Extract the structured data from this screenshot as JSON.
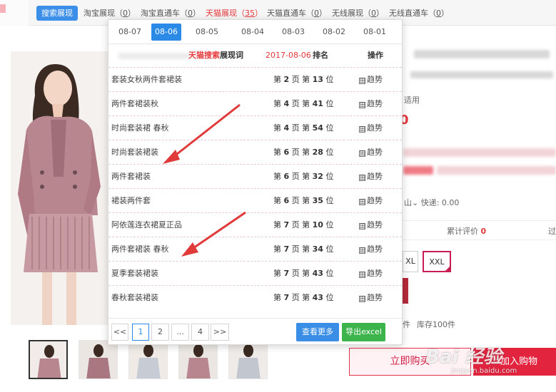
{
  "tabs": {
    "search_label": "搜索展现",
    "items": [
      {
        "label": "淘宝展现（",
        "count": "0",
        "close": "）"
      },
      {
        "label": "淘宝直通车（",
        "count": "0",
        "close": "）"
      },
      {
        "label": "天猫展现（",
        "count": "35",
        "close": "）"
      },
      {
        "label": "天猫直通车（",
        "count": "0",
        "close": "）"
      },
      {
        "label": "无线展现（",
        "count": "0",
        "close": "）"
      },
      {
        "label": "无线直通车（",
        "count": "0",
        "close": "）"
      }
    ],
    "active_index": 2
  },
  "popup": {
    "dates": [
      "08-07",
      "08-06",
      "08-05",
      "08-04",
      "08-03",
      "08-02",
      "08-01"
    ],
    "active_date_index": 1,
    "header": {
      "keyword_prefix": "天猫搜索",
      "keyword_suffix": "展现词",
      "date": "2017-08-06",
      "rank": "排名",
      "op": "操作"
    },
    "rows": [
      {
        "keyword": "套装女秋两件套裙装",
        "page": "2",
        "pos": "13"
      },
      {
        "keyword": "两件套裙装秋",
        "page": "4",
        "pos": "41"
      },
      {
        "keyword": "时尚套装裙 春秋",
        "page": "4",
        "pos": "54"
      },
      {
        "keyword": "时尚套装裙装",
        "page": "6",
        "pos": "28"
      },
      {
        "keyword": "两件套裙装",
        "page": "6",
        "pos": "32"
      },
      {
        "keyword": "裙装两件套",
        "page": "6",
        "pos": "35"
      },
      {
        "keyword": "阿依莲连衣裙夏正品",
        "page": "7",
        "pos": "10"
      },
      {
        "keyword": "两件套裙装 春秋",
        "page": "7",
        "pos": "34"
      },
      {
        "keyword": "夏季套装裙装",
        "page": "7",
        "pos": "43"
      },
      {
        "keyword": "春秋套装裙装",
        "page": "7",
        "pos": "43"
      }
    ],
    "rank_words": {
      "di": "第",
      "ye": "页",
      "wei": "位"
    },
    "trend_label": "趋势",
    "trend_box": "田",
    "pager": {
      "prev": "<<",
      "pages": [
        "1",
        "2",
        "...",
        "4"
      ],
      "current": "1",
      "next": ">>",
      "more": "查看更多",
      "excel": "导出excel"
    }
  },
  "product": {
    "applicable": "适用",
    "price_fragment": "0",
    "shipping": "快递: 0.00",
    "shipping_prefix": "山",
    "reviews_label": "累计评价",
    "reviews_count": "0",
    "reviews_tail": "过",
    "sizes": [
      "XL",
      "XXL"
    ],
    "selected_size": "XXL",
    "stock_prefix": "件",
    "stock": "库存100件",
    "buy_now": "立即购买",
    "add_cart": "加入购物"
  },
  "watermark": {
    "text": "Bai 经验",
    "sub": "jingyan.baidu.com"
  },
  "colors": {
    "accent_blue": "#2b8ae6",
    "accent_red": "#e4393c",
    "excel_green": "#3cb44b",
    "annotation_arrow": "#e03a3a"
  }
}
